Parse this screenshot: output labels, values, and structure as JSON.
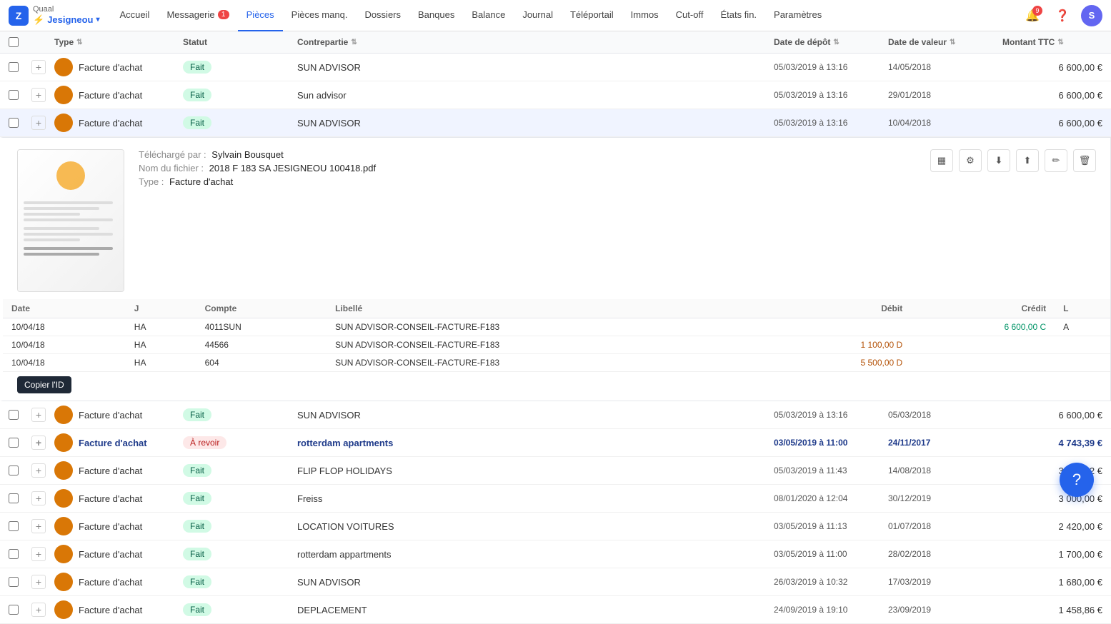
{
  "brand": {
    "logo_text": "Z",
    "company_label": "Quaal",
    "user_label": "Jesigneou",
    "bolt": "⚡"
  },
  "nav": {
    "items": [
      {
        "id": "accueil",
        "label": "Accueil",
        "badge": null,
        "active": false
      },
      {
        "id": "messagerie",
        "label": "Messagerie",
        "badge": "1",
        "active": false
      },
      {
        "id": "pieces",
        "label": "Pièces",
        "badge": null,
        "active": true
      },
      {
        "id": "pieces-manq",
        "label": "Pièces manq.",
        "badge": null,
        "active": false
      },
      {
        "id": "dossiers",
        "label": "Dossiers",
        "badge": null,
        "active": false
      },
      {
        "id": "banques",
        "label": "Banques",
        "badge": null,
        "active": false
      },
      {
        "id": "balance",
        "label": "Balance",
        "badge": null,
        "active": false
      },
      {
        "id": "journal",
        "label": "Journal",
        "badge": null,
        "active": false
      },
      {
        "id": "teleportail",
        "label": "Téléportail",
        "badge": null,
        "active": false
      },
      {
        "id": "immos",
        "label": "Immos",
        "badge": null,
        "active": false
      },
      {
        "id": "cutoff",
        "label": "Cut-off",
        "badge": null,
        "active": false
      },
      {
        "id": "etats-fin",
        "label": "États fin.",
        "badge": null,
        "active": false
      },
      {
        "id": "parametres",
        "label": "Paramètres",
        "badge": null,
        "active": false
      }
    ],
    "notif_badge": "9"
  },
  "table": {
    "columns": [
      {
        "id": "type",
        "label": "Type",
        "sortable": true
      },
      {
        "id": "statut",
        "label": "Statut",
        "sortable": false
      },
      {
        "id": "contrepartie",
        "label": "Contrepartie",
        "sortable": true
      },
      {
        "id": "date_depot",
        "label": "Date de dépôt",
        "sortable": true
      },
      {
        "id": "date_valeur",
        "label": "Date de valeur",
        "sortable": true
      },
      {
        "id": "montant_ttc",
        "label": "Montant TTC",
        "sortable": true
      }
    ],
    "rows": [
      {
        "id": 1,
        "type": "Facture d'achat",
        "statut": "Fait",
        "contrepartie": "SUN ADVISOR",
        "date_depot": "05/03/2019 à 13:16",
        "date_valeur": "14/05/2018",
        "montant": "6 600,00 €",
        "expanded": false,
        "highlight": false
      },
      {
        "id": 2,
        "type": "Facture d'achat",
        "statut": "Fait",
        "contrepartie": "Sun advisor",
        "date_depot": "05/03/2019 à 13:16",
        "date_valeur": "29/01/2018",
        "montant": "6 600,00 €",
        "expanded": false,
        "highlight": false
      },
      {
        "id": 3,
        "type": "Facture d'achat",
        "statut": "Fait",
        "contrepartie": "SUN ADVISOR",
        "date_depot": "05/03/2019 à 13:16",
        "date_valeur": "10/04/2018",
        "montant": "6 600,00 €",
        "expanded": true,
        "highlight": false
      },
      {
        "id": 4,
        "type": "Facture d'achat",
        "statut": "Fait",
        "contrepartie": "SUN ADVISOR",
        "date_depot": "05/03/2019 à 13:16",
        "date_valeur": "05/03/2018",
        "montant": "6 600,00 €",
        "expanded": false,
        "highlight": false
      },
      {
        "id": 5,
        "type": "Facture d'achat",
        "statut": "À revoir",
        "contrepartie": "rotterdam apartments",
        "date_depot": "03/05/2019 à 11:00",
        "date_valeur": "24/11/2017",
        "montant": "4 743,39 €",
        "expanded": false,
        "highlight": true
      },
      {
        "id": 6,
        "type": "Facture d'achat",
        "statut": "Fait",
        "contrepartie": "FLIP FLOP HOLIDAYS",
        "date_depot": "05/03/2019 à 11:43",
        "date_valeur": "14/08/2018",
        "montant": "3 248,02 €",
        "expanded": false,
        "highlight": false
      },
      {
        "id": 7,
        "type": "Facture d'achat",
        "statut": "Fait",
        "contrepartie": "Freiss",
        "date_depot": "08/01/2020 à 12:04",
        "date_valeur": "30/12/2019",
        "montant": "3 000,00 €",
        "expanded": false,
        "highlight": false
      },
      {
        "id": 8,
        "type": "Facture d'achat",
        "statut": "Fait",
        "contrepartie": "LOCATION VOITURES",
        "date_depot": "03/05/2019 à 11:13",
        "date_valeur": "01/07/2018",
        "montant": "2 420,00 €",
        "expanded": false,
        "highlight": false
      },
      {
        "id": 9,
        "type": "Facture d'achat",
        "statut": "Fait",
        "contrepartie": "rotterdam appartments",
        "date_depot": "03/05/2019 à 11:00",
        "date_valeur": "28/02/2018",
        "montant": "1 700,00 €",
        "expanded": false,
        "highlight": false
      },
      {
        "id": 10,
        "type": "Facture d'achat",
        "statut": "Fait",
        "contrepartie": "SUN ADVISOR",
        "date_depot": "26/03/2019 à 10:32",
        "date_valeur": "17/03/2019",
        "montant": "1 680,00 €",
        "expanded": false,
        "highlight": false
      },
      {
        "id": 11,
        "type": "Facture d'achat",
        "statut": "Fait",
        "contrepartie": "DEPLACEMENT",
        "date_depot": "24/09/2019 à 19:10",
        "date_valeur": "23/09/2019",
        "montant": "1 458,86 €",
        "expanded": false,
        "highlight": false
      }
    ]
  },
  "detail": {
    "uploader_label": "Téléchargé par :",
    "uploader": "Sylvain Bousquet",
    "filename_label": "Nom du fichier :",
    "filename": "2018 F 183 SA JESIGNEOU 100418.pdf",
    "type_label": "Type :",
    "type": "Facture d'achat",
    "actions": [
      {
        "id": "grid",
        "icon": "▦",
        "title": "Vue grille"
      },
      {
        "id": "settings",
        "icon": "⚙",
        "title": "Paramètres"
      },
      {
        "id": "download",
        "icon": "⬇",
        "title": "Télécharger"
      },
      {
        "id": "upload",
        "icon": "⬆",
        "title": "Envoyer"
      },
      {
        "id": "edit",
        "icon": "✏",
        "title": "Modifier"
      },
      {
        "id": "delete",
        "icon": "🗑",
        "title": "Supprimer"
      }
    ],
    "sub_table": {
      "columns": [
        "Date",
        "J",
        "Compte",
        "Libellé",
        "Débit",
        "Crédit",
        "L"
      ],
      "rows": [
        {
          "date": "10/04/18",
          "j": "HA",
          "compte": "4011SUN",
          "libelle": "SUN ADVISOR-CONSEIL-FACTURE-F183",
          "debit": "",
          "credit": "6 600,00 C",
          "l": "A"
        },
        {
          "date": "10/04/18",
          "j": "HA",
          "compte": "44566",
          "libelle": "SUN ADVISOR-CONSEIL-FACTURE-F183",
          "debit": "1 100,00 D",
          "credit": "",
          "l": ""
        },
        {
          "date": "10/04/18",
          "j": "HA",
          "compte": "604",
          "libelle": "SUN ADVISOR-CONSEIL-FACTURE-F183",
          "debit": "5 500,00 D",
          "credit": "",
          "l": ""
        }
      ]
    },
    "tooltip": "Copier l'ID"
  }
}
